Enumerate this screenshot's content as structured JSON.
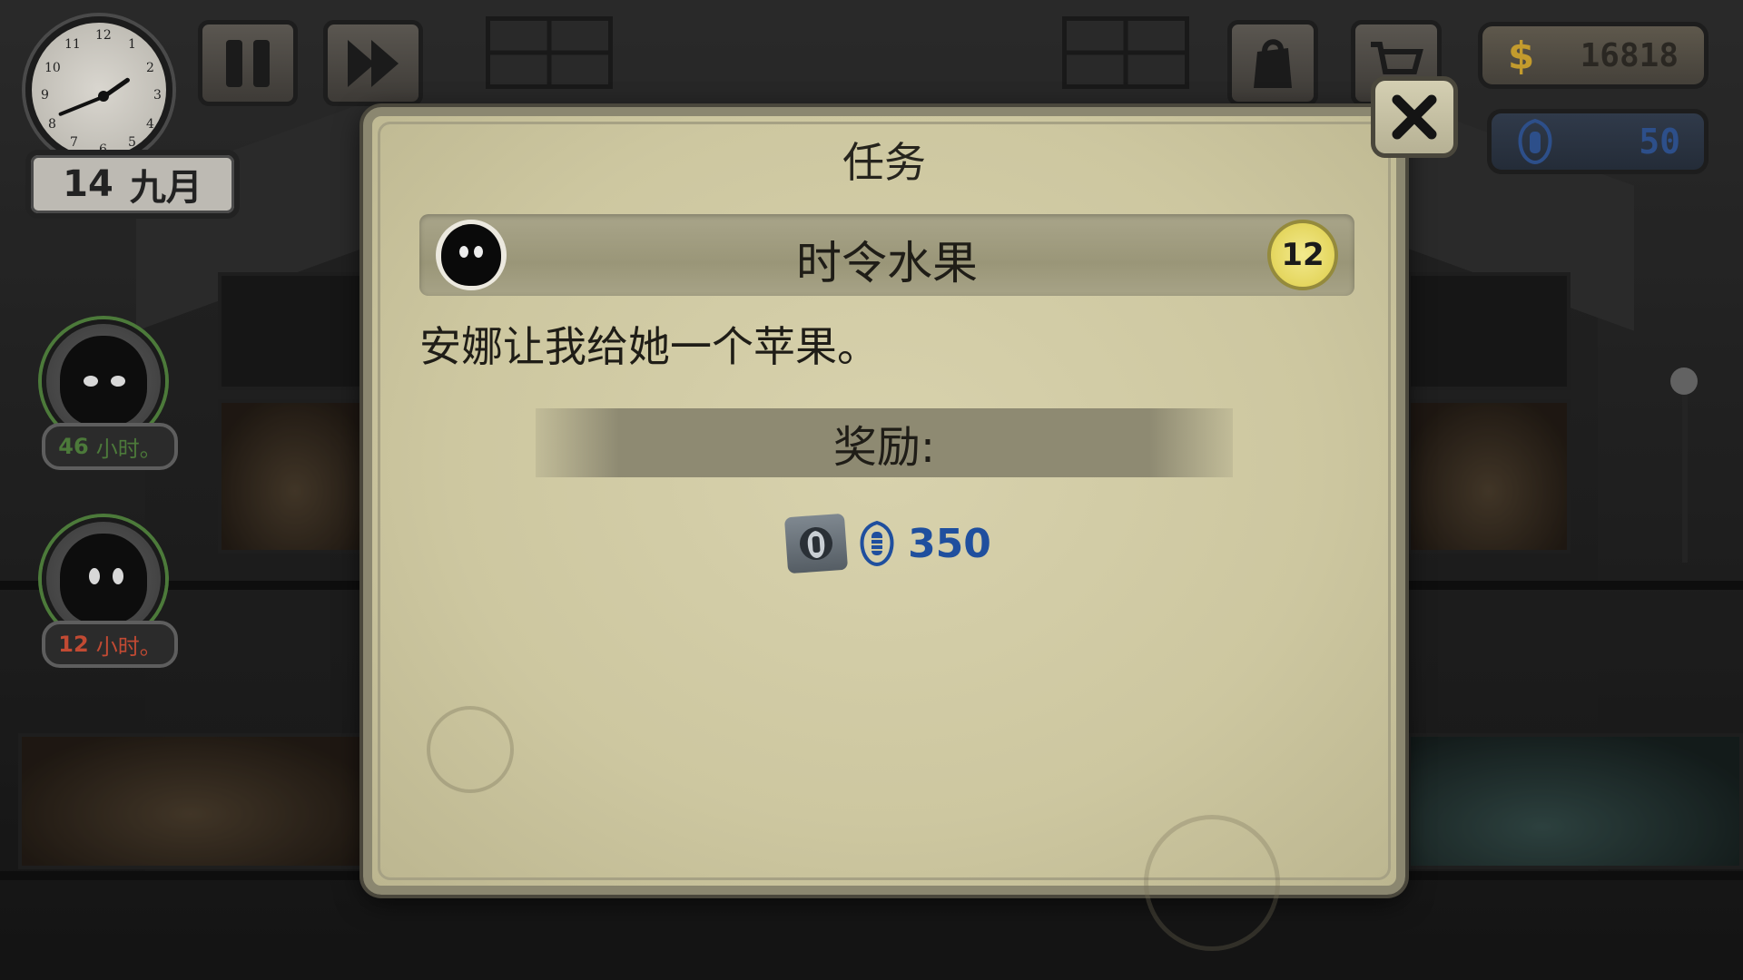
{
  "hud": {
    "clock": {
      "numbers": [
        "12",
        "1",
        "2",
        "3",
        "4",
        "5",
        "6",
        "7",
        "8",
        "9",
        "10",
        "11"
      ]
    },
    "date": {
      "day": "14",
      "month": "九月"
    },
    "pause_icon": "pause-icon",
    "fast_forward_icon": "fast-forward-icon",
    "inventory_icon": "bag-icon",
    "shop_icon": "cart-icon",
    "money": {
      "symbol": "$",
      "value": "16818"
    },
    "reputation": {
      "icon": "beetle-emblem-icon",
      "value": "50"
    }
  },
  "tenants": [
    {
      "hours": "46",
      "unit": "小时。",
      "hours_color": "#4c7a3a"
    },
    {
      "hours": "12",
      "unit": "小时。",
      "hours_color": "#b83a2b"
    }
  ],
  "modal": {
    "title": "任务",
    "quest": {
      "name": "时令水果",
      "level": "12",
      "description": "安娜让我给她一个苹果。"
    },
    "reward": {
      "label": "奖励:",
      "item_icon": "ministry-badge-icon",
      "currency_icon": "beetle-emblem-icon",
      "value": "350"
    },
    "close_icon": "close-icon"
  },
  "colors": {
    "paper": "#cdc7a0",
    "reward_blue": "#1f4f9e",
    "money_gold": "#c39b2d",
    "level_yellow": "#e4d65e"
  }
}
